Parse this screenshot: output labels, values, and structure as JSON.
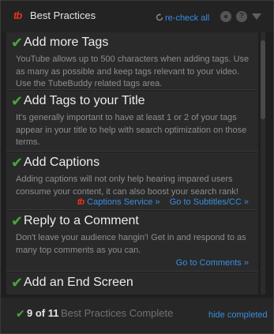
{
  "header": {
    "logo": "tb",
    "title": "Best Practices",
    "recheck_label": "re-check all",
    "help_glyph": "?"
  },
  "items": [
    {
      "title": "Add more Tags",
      "description": "YouTube allows up to 500 characters when adding tags. Use as many as possible and keep tags relevant to your video. Use the TubeBuddy related tags area."
    },
    {
      "title": "Add Tags to your Title",
      "description": "It's generally important to have at least 1 or 2 of your tags appear in your title to help with search optimization on those terms."
    },
    {
      "title": "Add Captions",
      "description": "Adding captions will not only help hearing impared users consume your content, it can also boost your search rank!",
      "links": [
        "Captions Service »",
        "Go to Subtitles/CC »"
      ]
    },
    {
      "title": "Reply to a Comment",
      "description": "Don't leave your audience hangin'! Get in and respond to as many top comments as you can.",
      "links": [
        "Go to Comments »"
      ]
    },
    {
      "title": "Add an End Screen",
      "description": ""
    }
  ],
  "footer": {
    "count": "9 of 11",
    "label": "Best Practices Complete",
    "hide_label": "hide completed"
  },
  "colors": {
    "accent": "#3a8de0",
    "check_green": "#48a83b",
    "brand_red": "#e8331c"
  },
  "icons": {
    "check": "check-icon",
    "recheck": "refresh-icon",
    "settings": "gear-icon",
    "help": "help-icon",
    "collapse": "chevron-down-icon"
  }
}
